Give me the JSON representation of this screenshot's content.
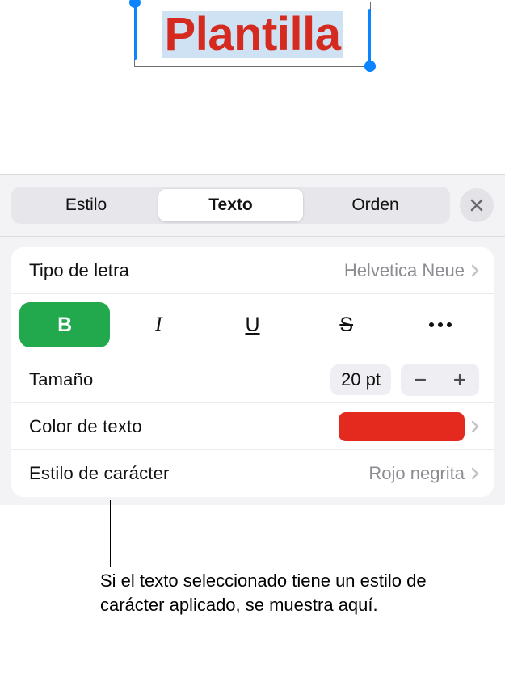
{
  "canvas": {
    "text": "Plantilla",
    "text_color": "#d52a20",
    "highlight_color": "#cfe2f3",
    "handle_color": "#0a84ff"
  },
  "tabs": {
    "items": [
      "Estilo",
      "Texto",
      "Orden"
    ],
    "active_index": 1
  },
  "font_row": {
    "label": "Tipo de letra",
    "value": "Helvetica Neue"
  },
  "style_buttons": {
    "bold": "B",
    "italic": "I",
    "underline": "U",
    "strike": "S"
  },
  "size_row": {
    "label": "Tamaño",
    "value": "20 pt"
  },
  "color_row": {
    "label": "Color de texto",
    "swatch": "#e42a1e"
  },
  "charstyle_row": {
    "label": "Estilo de carácter",
    "value": "Rojo negrita"
  },
  "callout": {
    "text": "Si el texto seleccionado tiene un estilo de carácter aplicado, se muestra aquí."
  }
}
